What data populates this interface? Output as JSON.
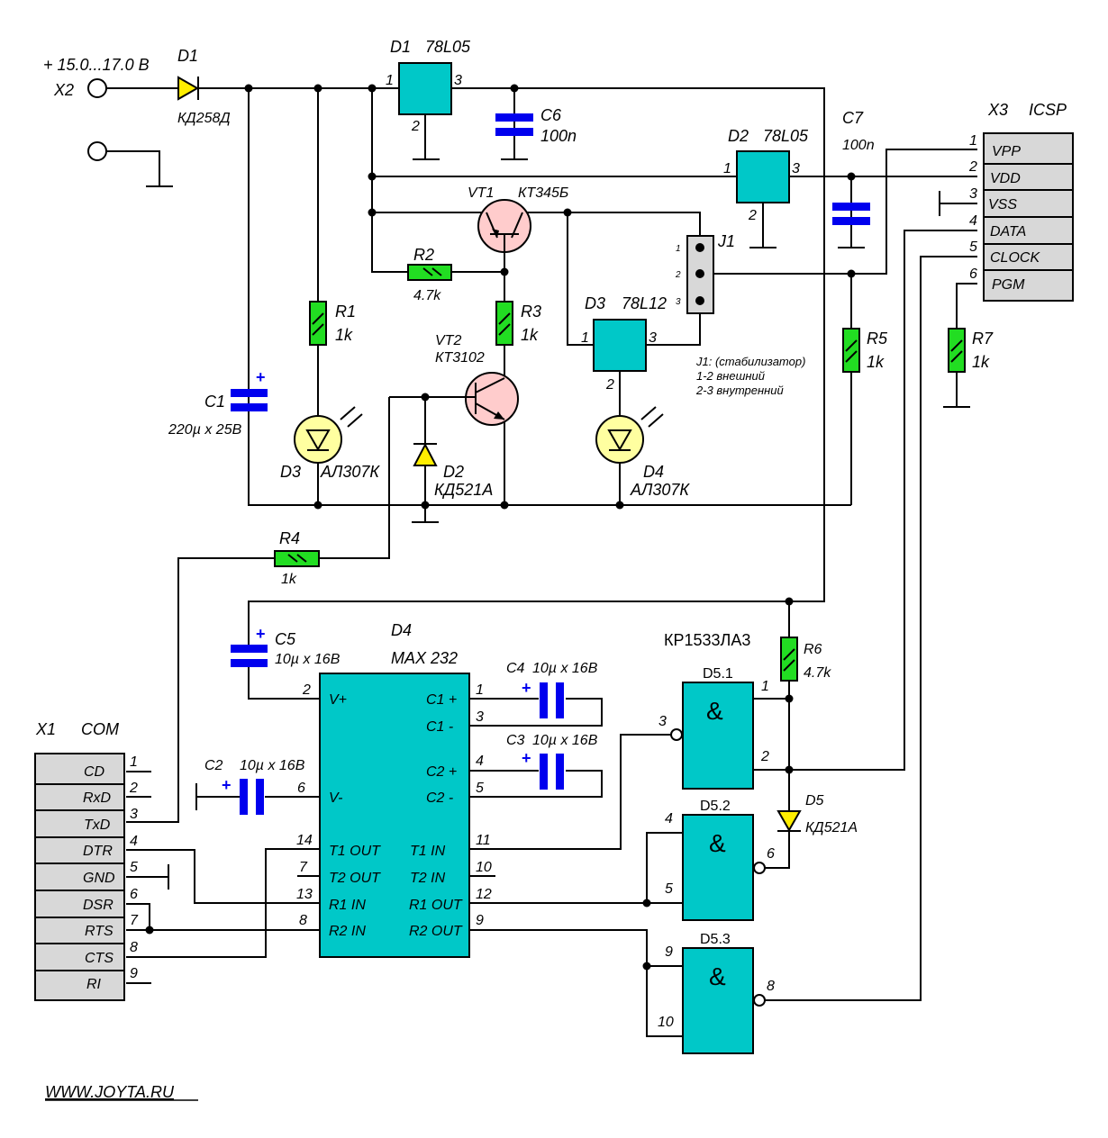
{
  "x2": {
    "ref": "X2",
    "voltage": "+ 15.0...17.0 В"
  },
  "d1_diode": {
    "ref": "D1",
    "part": "КД258Д"
  },
  "d1_reg": {
    "ref": "D1",
    "part": "78L05",
    "pin1": "1",
    "pin2": "2",
    "pin3": "3"
  },
  "c6": {
    "ref": "C6",
    "value": "100n"
  },
  "d2_reg": {
    "ref": "D2",
    "part": "78L05",
    "pin1": "1",
    "pin2": "2",
    "pin3": "3"
  },
  "c7": {
    "ref": "C7",
    "value": "100n"
  },
  "vt1": {
    "ref": "VT1",
    "part": "КТ345Б"
  },
  "vt2": {
    "ref": "VT2",
    "part": "КТ3102"
  },
  "r1": {
    "ref": "R1",
    "value": "1k"
  },
  "r2": {
    "ref": "R2",
    "value": "4.7k"
  },
  "r3": {
    "ref": "R3",
    "value": "1k"
  },
  "r4": {
    "ref": "R4",
    "value": "1k"
  },
  "r5": {
    "ref": "R5",
    "value": "1k"
  },
  "r6": {
    "ref": "R6",
    "value": "4.7k"
  },
  "r7": {
    "ref": "R7",
    "value": "1k"
  },
  "c1": {
    "ref": "C1",
    "value": "220µ x 25В",
    "polarity": "+"
  },
  "led_d3": {
    "ref": "D3",
    "part": "АЛ307К"
  },
  "led_d4": {
    "ref": "D4",
    "part": "АЛ307К"
  },
  "d2_diode": {
    "ref": "D2",
    "part": "КД521А"
  },
  "d3_reg": {
    "ref": "D3",
    "part": "78L12",
    "pin1": "1",
    "pin2": "2",
    "pin3": "3"
  },
  "j1": {
    "ref": "J1",
    "pins": [
      "1",
      "2",
      "3"
    ],
    "note": [
      "J1: (стабилизатор)",
      "1-2  внешний",
      "2-3  внутренний"
    ]
  },
  "x3": {
    "ref": "X3",
    "name": "ICSP",
    "pins": [
      {
        "num": "1",
        "name": "VPP"
      },
      {
        "num": "2",
        "name": "VDD"
      },
      {
        "num": "3",
        "name": "VSS"
      },
      {
        "num": "4",
        "name": "DATA"
      },
      {
        "num": "5",
        "name": "CLOCK"
      },
      {
        "num": "6",
        "name": "PGM"
      }
    ]
  },
  "c5": {
    "ref": "C5",
    "value": "10µ x 16В",
    "polarity": "+"
  },
  "c4": {
    "ref": "C4",
    "value": "10µ x 16В",
    "polarity": "+"
  },
  "c3": {
    "ref": "C3",
    "value": "10µ x 16В",
    "polarity": "+"
  },
  "c2": {
    "ref": "C2",
    "value": "10µ x 16В",
    "polarity": "+"
  },
  "d4_max": {
    "ref": "D4",
    "part": "MAX 232",
    "left": [
      {
        "num": "2",
        "name": "V+"
      },
      {
        "num": "6",
        "name": "V-"
      },
      {
        "num": "14",
        "name": "T1 OUT"
      },
      {
        "num": "7",
        "name": "T2 OUT"
      },
      {
        "num": "13",
        "name": "R1 IN"
      },
      {
        "num": "8",
        "name": "R2 IN"
      }
    ],
    "right": [
      {
        "num": "1",
        "name": "C1 +"
      },
      {
        "num": "3",
        "name": "C1 -"
      },
      {
        "num": "4",
        "name": "C2 +"
      },
      {
        "num": "5",
        "name": "C2 -"
      },
      {
        "num": "11",
        "name": "T1 IN"
      },
      {
        "num": "10",
        "name": "T2 IN"
      },
      {
        "num": "12",
        "name": "R1 OUT"
      },
      {
        "num": "9",
        "name": "R2 OUT"
      }
    ]
  },
  "x1": {
    "ref": "X1",
    "name": "COM",
    "pins": [
      {
        "num": "1",
        "name": "CD"
      },
      {
        "num": "2",
        "name": "RxD"
      },
      {
        "num": "3",
        "name": "TxD"
      },
      {
        "num": "4",
        "name": "DTR"
      },
      {
        "num": "5",
        "name": "GND"
      },
      {
        "num": "6",
        "name": "DSR"
      },
      {
        "num": "7",
        "name": "RTS"
      },
      {
        "num": "8",
        "name": "CTS"
      },
      {
        "num": "9",
        "name": "RI"
      }
    ]
  },
  "d5": {
    "part": "КР1533ЛА3",
    "symbol": "&",
    "g1": {
      "ref": "D5.1",
      "in1": "1",
      "in2": "2",
      "out": "3"
    },
    "g2": {
      "ref": "D5.2",
      "in1": "4",
      "in2": "5",
      "out": "6"
    },
    "g3": {
      "ref": "D5.3",
      "in1": "9",
      "in2": "10",
      "out": "8"
    }
  },
  "d5_diode": {
    "ref": "D5",
    "part": "КД521А"
  },
  "website": "WWW.JOYTA.RU",
  "colors": {
    "chip": "#00c8c8",
    "resistor": "#22dd22",
    "capacitor": "#0000ee",
    "diode": "#ffee00",
    "led": "#ffffa0",
    "transistor": "#ffcccc",
    "connector": "#d8d8d8"
  }
}
